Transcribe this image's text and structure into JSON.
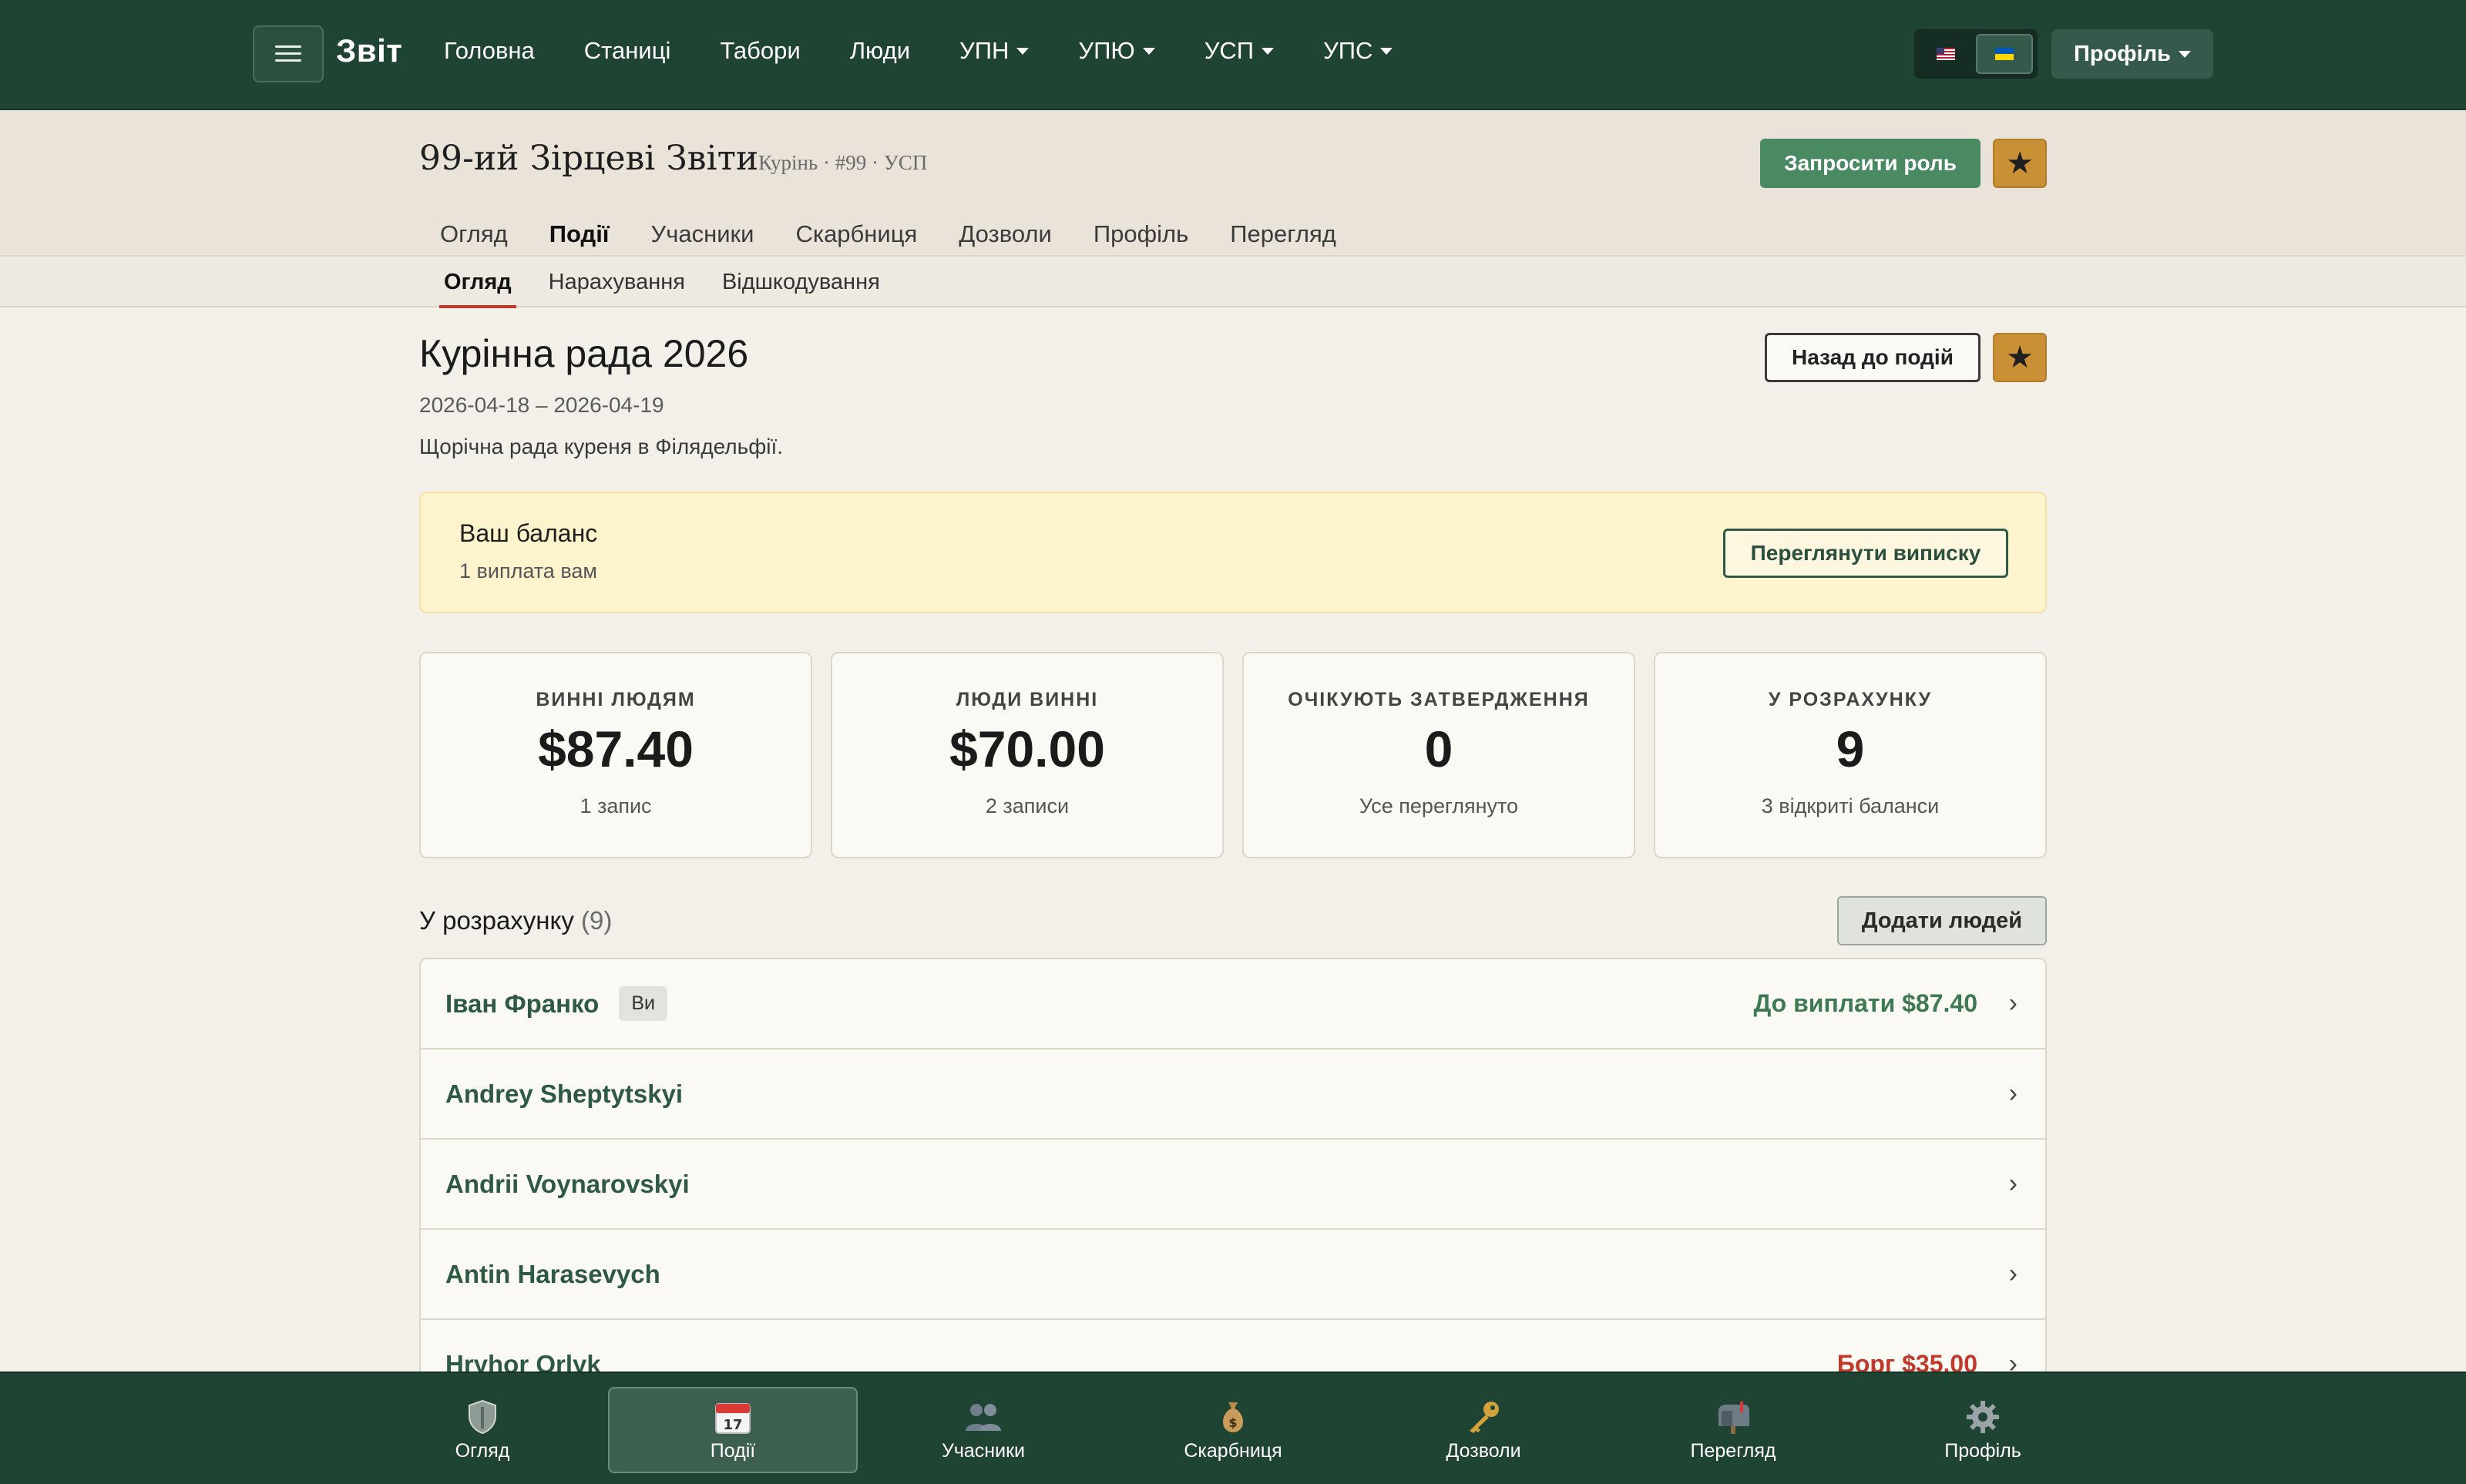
{
  "topnav": {
    "brand": "Звіт",
    "links": [
      "Головна",
      "Станиці",
      "Табори",
      "Люди"
    ],
    "dropdowns": [
      "УПН",
      "УПЮ",
      "УСП",
      "УПС"
    ],
    "profile_label": "Профіль"
  },
  "header": {
    "org_title": "99-ий Зірцеві Звіти",
    "org_meta": "Курінь · #99 · УСП",
    "request_role_label": "Запросити роль",
    "tabs": [
      "Огляд",
      "Події",
      "Учасники",
      "Скарбниця",
      "Дозволи",
      "Профіль",
      "Перегляд"
    ],
    "active_tab": "Події"
  },
  "subtabs": {
    "items": [
      "Огляд",
      "Нарахування",
      "Відшкодування"
    ],
    "active": "Огляд"
  },
  "event": {
    "title": "Курінна рада 2026",
    "dates": "2026-04-18 – 2026-04-19",
    "description": "Щорічна рада куреня в Філядельфії.",
    "back_label": "Назад до подій"
  },
  "balance": {
    "title": "Ваш баланс",
    "subtitle": "1 виплата вам",
    "statement_label": "Переглянути виписку"
  },
  "stats": [
    {
      "label": "ВИННІ ЛЮДЯМ",
      "value": "$87.40",
      "sub": "1 запис"
    },
    {
      "label": "ЛЮДИ ВИННІ",
      "value": "$70.00",
      "sub": "2 записи"
    },
    {
      "label": "ОЧІКУЮТЬ ЗАТВЕРДЖЕННЯ",
      "value": "0",
      "sub": "Усе переглянуто"
    },
    {
      "label": "У РОЗРАХУНКУ",
      "value": "9",
      "sub": "3 відкриті баланси"
    }
  ],
  "list": {
    "title": "У розрахунку",
    "count": "(9)",
    "add_label": "Додати людей",
    "people": [
      {
        "name": "Іван Франко",
        "badge": "Ви",
        "amount": "До виплати $87.40"
      },
      {
        "name": "Andrey Sheptytskyi",
        "amount": ""
      },
      {
        "name": "Andrii Voynarovskyi",
        "amount": ""
      },
      {
        "name": "Antin Harasevych",
        "amount": ""
      },
      {
        "name": "Hryhor Orlyk",
        "amount": "Борг $35.00"
      }
    ]
  },
  "bottomnav": {
    "items": [
      {
        "label": "Огляд",
        "icon": "shield-icon"
      },
      {
        "label": "Події",
        "icon": "calendar-icon"
      },
      {
        "label": "Учасники",
        "icon": "people-icon"
      },
      {
        "label": "Скарбниця",
        "icon": "money-bag-icon"
      },
      {
        "label": "Дозволи",
        "icon": "key-icon"
      },
      {
        "label": "Перегляд",
        "icon": "mailbox-icon"
      },
      {
        "label": "Профіль",
        "icon": "gear-icon"
      }
    ],
    "active": "Події"
  },
  "colors": {
    "nav_bg": "#1f4433",
    "accent_green": "#4a8a63",
    "star_gold": "#c99036",
    "active_underline": "#c0392b",
    "balance_bg": "#fdf3cd",
    "positive": "#3d7a53",
    "negative": "#c0392b"
  }
}
